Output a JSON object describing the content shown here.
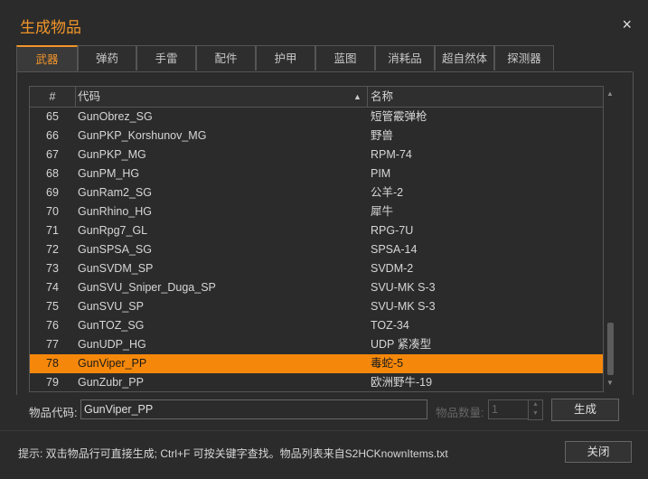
{
  "window": {
    "title": "生成物品",
    "close_glyph": "×"
  },
  "tabs": [
    "武器",
    "弹药",
    "手雷",
    "配件",
    "护甲",
    "蓝图",
    "消耗品",
    "超自然体",
    "探测器"
  ],
  "table": {
    "headers": {
      "num": "#",
      "code": "代码",
      "name": "名称"
    },
    "sort_glyph": "▲",
    "rows": [
      {
        "num": "65",
        "code": "GunObrez_SG",
        "name": "短管霰弹枪"
      },
      {
        "num": "66",
        "code": "GunPKP_Korshunov_MG",
        "name": "野兽"
      },
      {
        "num": "67",
        "code": "GunPKP_MG",
        "name": "RPM-74"
      },
      {
        "num": "68",
        "code": "GunPM_HG",
        "name": "PIM"
      },
      {
        "num": "69",
        "code": "GunRam2_SG",
        "name": "公羊-2"
      },
      {
        "num": "70",
        "code": "GunRhino_HG",
        "name": "犀牛"
      },
      {
        "num": "71",
        "code": "GunRpg7_GL",
        "name": "RPG-7U"
      },
      {
        "num": "72",
        "code": "GunSPSA_SG",
        "name": "SPSA-14"
      },
      {
        "num": "73",
        "code": "GunSVDM_SP",
        "name": "SVDM-2"
      },
      {
        "num": "74",
        "code": "GunSVU_Sniper_Duga_SP",
        "name": "SVU-MK S-3"
      },
      {
        "num": "75",
        "code": "GunSVU_SP",
        "name": "SVU-MK S-3"
      },
      {
        "num": "76",
        "code": "GunTOZ_SG",
        "name": "TOZ-34"
      },
      {
        "num": "77",
        "code": "GunUDP_HG",
        "name": "UDP 紧凑型"
      },
      {
        "num": "78",
        "code": "GunViper_PP",
        "name": "毒蛇-5"
      },
      {
        "num": "79",
        "code": "GunZubr_PP",
        "name": "欧洲野牛-19"
      }
    ],
    "selected_num": "78"
  },
  "scrollbar": {
    "up_glyph": "▲",
    "down_glyph": "▼"
  },
  "form": {
    "code_label": "物品代码:",
    "code_value": "GunViper_PP",
    "qty_label": "物品数量:",
    "qty_value": "1",
    "spin_up": "▲",
    "spin_down": "▼",
    "generate_label": "生成"
  },
  "footer": {
    "hint": "提示: 双击物品行可直接生成; Ctrl+F 可按关键字查找。物品列表来自S2HCKnownItems.txt",
    "close_label": "关闭"
  },
  "colors": {
    "accent": "#f0952a",
    "selected_row": "#f5880a",
    "background": "#2b2b2b"
  }
}
